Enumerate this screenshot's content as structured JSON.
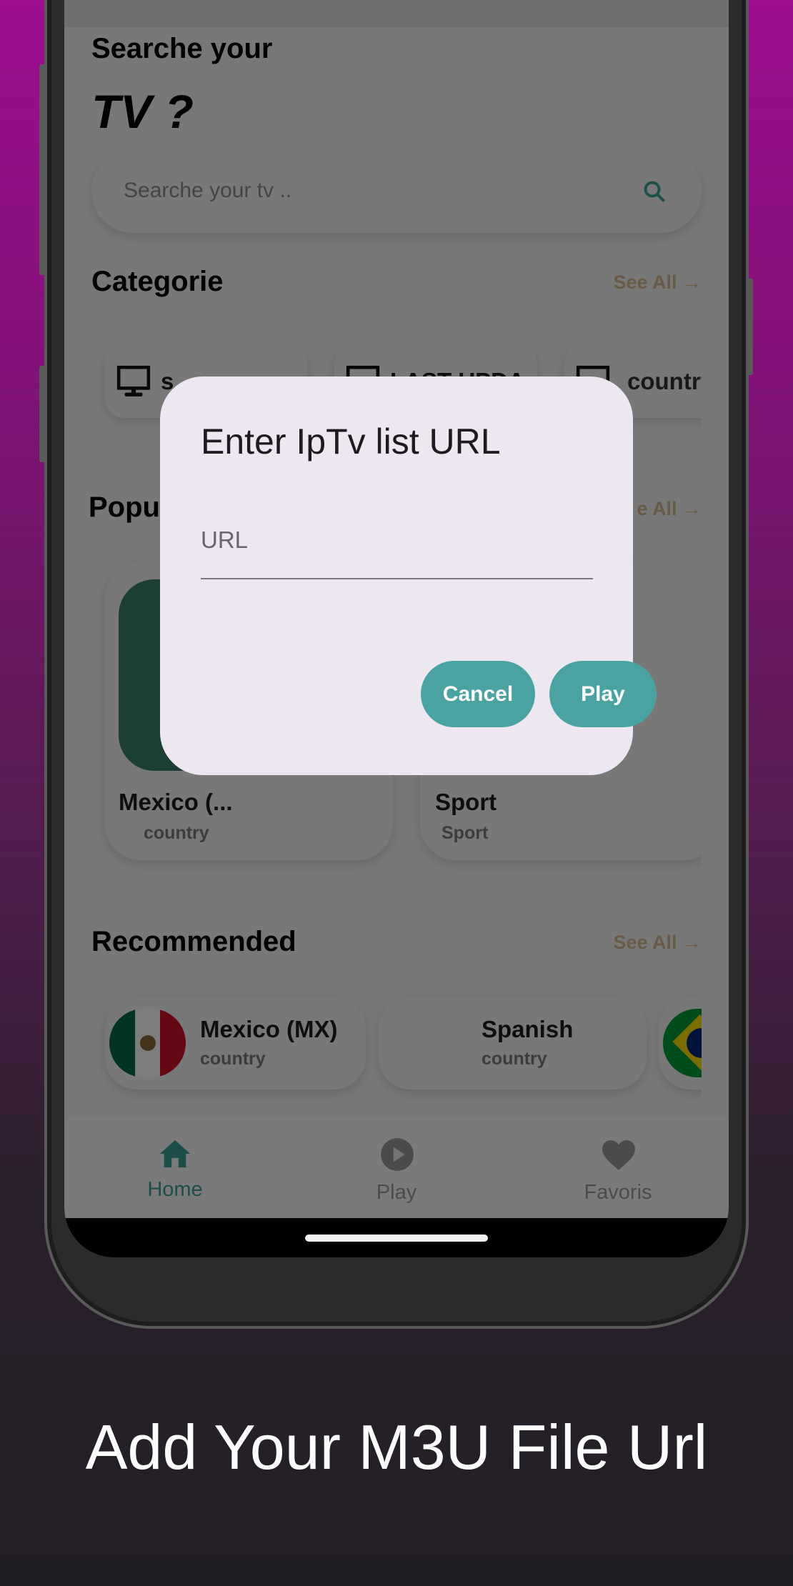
{
  "header": {
    "line1": "Searche your",
    "line2": "TV ?"
  },
  "search": {
    "placeholder": "Searche your tv .."
  },
  "sections": {
    "categorie": {
      "title": "Categorie",
      "see_all": "See All"
    },
    "popular": {
      "title": "Popu",
      "see_all": "e All"
    },
    "recommended": {
      "title": "Recommended",
      "see_all": "See All"
    }
  },
  "categories": [
    {
      "label": "s"
    },
    {
      "label": "LAST UPDA"
    },
    {
      "label": "country"
    }
  ],
  "popular": [
    {
      "title": "Mexico (...",
      "subtitle": "country"
    },
    {
      "title": "Sport",
      "subtitle": "Sport"
    }
  ],
  "recommended": [
    {
      "title": "Mexico (MX)",
      "subtitle": "country"
    },
    {
      "title": "Spanish",
      "subtitle": "country"
    }
  ],
  "nav": {
    "items": [
      {
        "label": "Home",
        "icon": "home-icon",
        "active": true
      },
      {
        "label": "Play",
        "icon": "play-circle-icon"
      },
      {
        "label": "Favoris",
        "icon": "heart-icon"
      }
    ]
  },
  "dialog": {
    "title": "Enter IpTv list URL",
    "field_label": "URL",
    "cancel": "Cancel",
    "play": "Play"
  },
  "caption": "Add Your M3U File Url",
  "colors": {
    "accent": "#4aa3a0",
    "see_all": "#d6b88f",
    "dialog_bg": "#ede7f1"
  }
}
